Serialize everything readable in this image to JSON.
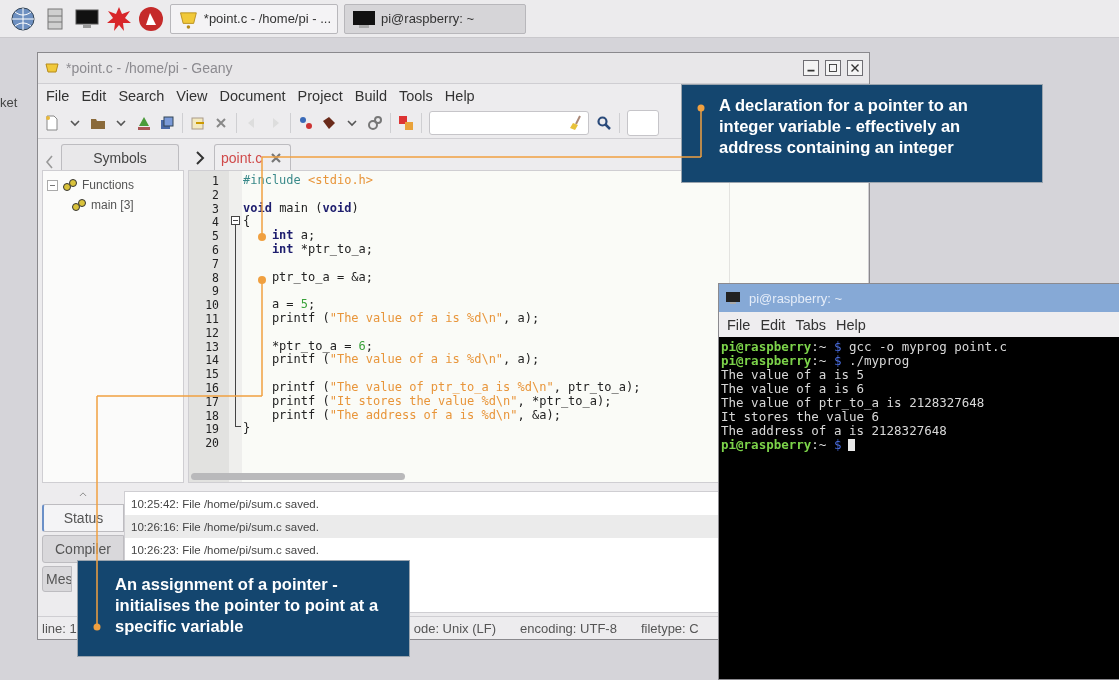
{
  "desktop": {
    "icon_label": "ket"
  },
  "taskbar": {
    "buttons": [
      {
        "kind": "editor",
        "label": "*point.c - /home/pi - ..."
      },
      {
        "kind": "terminal",
        "label": "pi@raspberry: ~"
      }
    ]
  },
  "editor_window": {
    "title": "*point.c - /home/pi - Geany",
    "menu": [
      "File",
      "Edit",
      "Search",
      "View",
      "Document",
      "Project",
      "Build",
      "Tools",
      "Help"
    ],
    "sidebar": {
      "tab": "Symbols",
      "tree": [
        {
          "label": "Functions",
          "expanded": true,
          "children": [
            {
              "label": "main [3]"
            }
          ]
        }
      ]
    },
    "file_tab": {
      "label": "point.c",
      "modified": true
    },
    "code_lines": [
      {
        "n": "1",
        "segments": [
          {
            "kind": "preproc",
            "text": "#include "
          },
          {
            "kind": "string",
            "text": "<stdio.h>"
          }
        ]
      },
      {
        "n": "2"
      },
      {
        "n": "3",
        "segments": [
          {
            "kind": "keyword",
            "text": "void"
          },
          {
            "kind": "text",
            "text": " main ("
          },
          {
            "kind": "keyword",
            "text": "void"
          },
          {
            "kind": "text",
            "text": ")"
          }
        ]
      },
      {
        "n": "4",
        "segments": [
          {
            "kind": "text",
            "text": "{"
          }
        ]
      },
      {
        "n": "5",
        "segments": [
          {
            "kind": "keyword",
            "text": "    int"
          },
          {
            "kind": "text",
            "text": " a;"
          }
        ]
      },
      {
        "n": "6",
        "segments": [
          {
            "kind": "keyword",
            "text": "    int"
          },
          {
            "kind": "text",
            "text": " *ptr_to_a;"
          }
        ]
      },
      {
        "n": "7"
      },
      {
        "n": "8",
        "segments": [
          {
            "kind": "text",
            "text": "    ptr_to_a = &a;"
          }
        ]
      },
      {
        "n": "9"
      },
      {
        "n": "10",
        "segments": [
          {
            "kind": "text",
            "text": "    a = "
          },
          {
            "kind": "number",
            "text": "5"
          },
          {
            "kind": "text",
            "text": ";"
          }
        ]
      },
      {
        "n": "11",
        "segments": [
          {
            "kind": "text",
            "text": "    printf ("
          },
          {
            "kind": "string",
            "text": "\"The value of a is %d\\n\""
          },
          {
            "kind": "text",
            "text": ", a);"
          }
        ]
      },
      {
        "n": "12"
      },
      {
        "n": "13",
        "segments": [
          {
            "kind": "text",
            "text": "    *ptr_to_a = "
          },
          {
            "kind": "number",
            "text": "6"
          },
          {
            "kind": "text",
            "text": ";"
          }
        ]
      },
      {
        "n": "14",
        "segments": [
          {
            "kind": "text",
            "text": "    printf ("
          },
          {
            "kind": "string",
            "text": "\"The value of a is %d\\n\""
          },
          {
            "kind": "text",
            "text": ", a);"
          }
        ]
      },
      {
        "n": "15"
      },
      {
        "n": "16",
        "segments": [
          {
            "kind": "text",
            "text": "    printf ("
          },
          {
            "kind": "string",
            "text": "\"The value of ptr_to_a is %d\\n\""
          },
          {
            "kind": "text",
            "text": ", ptr_to_a);"
          }
        ]
      },
      {
        "n": "17",
        "segments": [
          {
            "kind": "text",
            "text": "    printf ("
          },
          {
            "kind": "string",
            "text": "\"It stores the value %d\\n\""
          },
          {
            "kind": "text",
            "text": ", *ptr_to_a);"
          }
        ]
      },
      {
        "n": "18",
        "segments": [
          {
            "kind": "text",
            "text": "    printf ("
          },
          {
            "kind": "string",
            "text": "\"The address of a is %d\\n\""
          },
          {
            "kind": "text",
            "text": ", &a);"
          }
        ]
      },
      {
        "n": "19",
        "segments": [
          {
            "kind": "text",
            "text": "}"
          }
        ]
      },
      {
        "n": "20"
      }
    ],
    "message_tabs": [
      {
        "label": "Status",
        "selected": true
      },
      {
        "label": "Compiler",
        "selected": false
      },
      {
        "label": "Mes",
        "selected": false
      }
    ],
    "messages": [
      "10:25:42: File /home/pi/sum.c saved.",
      "10:26:16: File /home/pi/sum.c saved.",
      "10:26:23: File /home/pi/sum.c saved."
    ],
    "status_bar": [
      "line: 1",
      "ode: Unix (LF)",
      "encoding: UTF-8",
      "filetype: C"
    ]
  },
  "terminal_window": {
    "title": "pi@raspberry: ~",
    "menu": [
      "File",
      "Edit",
      "Tabs",
      "Help"
    ],
    "lines": [
      {
        "segments": [
          {
            "kind": "prompt",
            "text": "pi@raspberry"
          },
          {
            "kind": "path",
            "text": ":~ "
          },
          {
            "kind": "sign",
            "text": "$"
          },
          {
            "kind": "output",
            "text": " gcc -o myprog point.c"
          }
        ]
      },
      {
        "segments": [
          {
            "kind": "prompt",
            "text": "pi@raspberry"
          },
          {
            "kind": "path",
            "text": ":~ "
          },
          {
            "kind": "sign",
            "text": "$"
          },
          {
            "kind": "output",
            "text": " ./myprog"
          }
        ]
      },
      {
        "segments": [
          {
            "kind": "output",
            "text": "The value of a is 5"
          }
        ]
      },
      {
        "segments": [
          {
            "kind": "output",
            "text": "The value of a is 6"
          }
        ]
      },
      {
        "segments": [
          {
            "kind": "output",
            "text": "The value of ptr_to_a is 2128327648"
          }
        ]
      },
      {
        "segments": [
          {
            "kind": "output",
            "text": "It stores the value 6"
          }
        ]
      },
      {
        "segments": [
          {
            "kind": "output",
            "text": "The address of a is 2128327648"
          }
        ]
      },
      {
        "segments": [
          {
            "kind": "prompt",
            "text": "pi@raspberry"
          },
          {
            "kind": "path",
            "text": ":~ "
          },
          {
            "kind": "sign",
            "text": "$"
          }
        ],
        "cursor": true
      }
    ]
  },
  "callouts": [
    {
      "text": "A declaration for a pointer to an integer variable - effectively an address containing an integer"
    },
    {
      "text": "An assignment of a pointer - initialises the pointer to point at a specific variable"
    }
  ]
}
